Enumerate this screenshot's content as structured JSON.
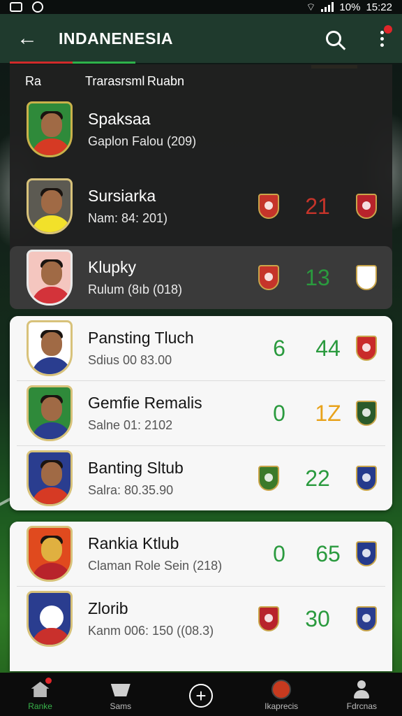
{
  "status_bar": {
    "battery": "10%",
    "time": "15:22"
  },
  "app_bar": {
    "title": "INDANENESIA",
    "back_icon": "arrow-left-icon",
    "search_icon": "search-icon",
    "more_icon": "more-vertical-icon"
  },
  "table": {
    "col_rank": "Ra",
    "col_name": "Trarasrsml Ruabn",
    "players": [
      {
        "name": "Spaksaa",
        "sub": "Gaplon Falou (209)",
        "stat_a": "",
        "stat_b": "",
        "shirt": "#d63a24",
        "badge_a": "",
        "badge_b": ""
      },
      {
        "name": "Sursiarka",
        "sub": "Nam: 84: 201)",
        "stat_a": "",
        "stat_b": "21",
        "shirt": "#f2e12a",
        "badge_a": "#c5342a",
        "badge_b": "#b8232b"
      },
      {
        "name": "Klupky",
        "sub": "Rulum (8ıb (018)",
        "stat_a": "",
        "stat_b": "13",
        "shirt": "#d3333a",
        "badge_a": "#c5342a",
        "badge_b": "#ffffff"
      },
      {
        "name": "Pansting Tluch",
        "sub": "Sdius 00 83.00",
        "stat_a": "6",
        "stat_b": "44",
        "shirt": "#2a3d8f",
        "badge_a": "",
        "badge_b": "#c92a2a"
      },
      {
        "name": "Gemfie Remalis",
        "sub": "Salne 01: 2102",
        "stat_a": "0",
        "stat_b": "1Z",
        "shirt": "#2a3d8f",
        "badge_a": "",
        "badge_b": "#2a5a2a"
      },
      {
        "name": "Banting Sltub",
        "sub": "Salra: 80.35.90",
        "stat_a": "",
        "stat_b": "22",
        "shirt": "#d63a24",
        "badge_a": "#3c7a2a",
        "badge_b": "#253a8c"
      },
      {
        "name": "Rankia Ktlub",
        "sub": "Claman Role Sein  (218)",
        "stat_a": "0",
        "stat_b": "65",
        "shirt": "#b8232b",
        "badge_a": "",
        "badge_b": "#253a8c"
      },
      {
        "name": "Zlorib",
        "sub": "Kanm 006: 150   ((08.3)",
        "stat_a": "",
        "stat_b": "30",
        "shirt": "#c9302c",
        "badge_a": "#b8232b",
        "badge_b": "#2a3d8f"
      }
    ]
  },
  "bottom_nav": {
    "items": [
      {
        "label": "Ranke",
        "icon": "home-icon"
      },
      {
        "label": "Sams",
        "icon": "scores-icon"
      },
      {
        "label": "",
        "icon": "add-circle-icon"
      },
      {
        "label": "Ikaprecis",
        "icon": "match-icon"
      },
      {
        "label": "Fdrcnas",
        "icon": "profile-icon"
      }
    ]
  },
  "colors": {
    "accent_yellow": "#f3c21a",
    "stat_green": "#2a9a3e",
    "stat_red": "#c5342a",
    "stat_orange": "#e8a21a"
  }
}
